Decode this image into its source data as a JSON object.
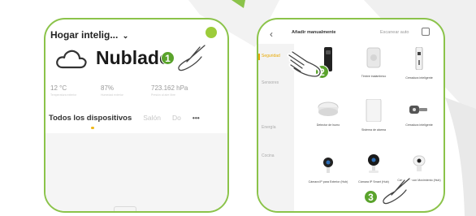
{
  "colors": {
    "brand_green": "#8bc34a",
    "step_green": "#5aa32c",
    "accent_yellow": "#e8a800",
    "gear_green": "#9ccc3a"
  },
  "screen1": {
    "home_name": "Hogar intelig...",
    "weather": "Nublado",
    "stats": [
      {
        "value": "12 °C",
        "label": "Temperatura exterior"
      },
      {
        "value": "87%",
        "label": "Humedad exterior"
      },
      {
        "value": "723.162 hPa",
        "label": "Presión al aire libre"
      }
    ],
    "tabs": [
      "Todos los dispositivos",
      "Salón",
      "Do"
    ],
    "more_tabs": "•••"
  },
  "screen2": {
    "title": "Añadir manualmente",
    "scan_label": "Escanear auto",
    "sidebar": [
      "Seguridad",
      "Sensores",
      "Energía",
      "Cocina"
    ],
    "devices": [
      "",
      "Timbre inalámbrico",
      "Cerradura inteligente",
      "Detector de humo",
      "Sistema de alarma",
      "Cerradura inteligente",
      "Cámara IP para Exterior (Hub)",
      "Cámara IP Smart (Hub)",
      "Cámara IP con Movimiento (Hub)"
    ]
  },
  "steps": [
    "1",
    "2",
    "3"
  ]
}
